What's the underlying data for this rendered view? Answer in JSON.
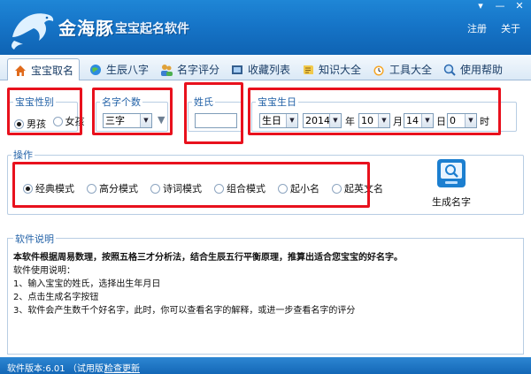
{
  "window": {
    "title": "金海豚",
    "subtitle": "宝宝起名软件",
    "register_label": "注册",
    "close_label": "关于"
  },
  "tabs": [
    {
      "label": "宝宝取名",
      "icon": "home-icon",
      "active": true
    },
    {
      "label": "生辰八字",
      "icon": "globe-icon",
      "active": false
    },
    {
      "label": "名字评分",
      "icon": "people-icon",
      "active": false
    },
    {
      "label": "收藏列表",
      "icon": "film-icon",
      "active": false
    },
    {
      "label": "知识大全",
      "icon": "scroll-icon",
      "active": false
    },
    {
      "label": "工具大全",
      "icon": "alarm-clock-icon",
      "active": false
    },
    {
      "label": "使用帮助",
      "icon": "magnifier-icon",
      "active": false
    }
  ],
  "gender": {
    "title": "宝宝性别",
    "options": [
      {
        "label": "男孩",
        "checked": true
      },
      {
        "label": "女孩",
        "checked": false
      }
    ]
  },
  "name_count": {
    "title": "名字个数",
    "selected": "三字"
  },
  "surname": {
    "title": "姓氏",
    "value": ""
  },
  "birthday": {
    "title": "宝宝生日",
    "calendar": "生日",
    "year": "2014",
    "year_unit": "年",
    "month": "10",
    "month_unit": "月",
    "day": "14",
    "day_unit": "日",
    "hour": "0",
    "hour_unit": "时"
  },
  "operation": {
    "title": "操作",
    "modes": [
      {
        "label": "经典模式",
        "checked": true
      },
      {
        "label": "高分模式",
        "checked": false
      },
      {
        "label": "诗词模式",
        "checked": false
      },
      {
        "label": "组合模式",
        "checked": false
      },
      {
        "label": "起小名",
        "checked": false
      },
      {
        "label": "起英文名",
        "checked": false
      }
    ],
    "generate_label": "生成名字"
  },
  "description": {
    "title": "软件说明",
    "lines": [
      "本软件根据周易数理，按照五格三才分析法，结合生辰五行平衡原理，推算出适合您宝宝的好名字。",
      "软件使用说明：",
      "1、输入宝宝的姓氏，选择出生年月日",
      "2、点击生成名字按钮",
      "3、软件会产生数千个好名字，此时，你可以查看名字的解释，或进一步查看名字的评分"
    ]
  },
  "statusbar": {
    "version": "软件版本:6.01 （试用版）",
    "update_label": "检查更新"
  },
  "colors": {
    "title_bar": "#1675c8",
    "highlight_border": "#e8111d",
    "group_title": "#2463a8"
  }
}
